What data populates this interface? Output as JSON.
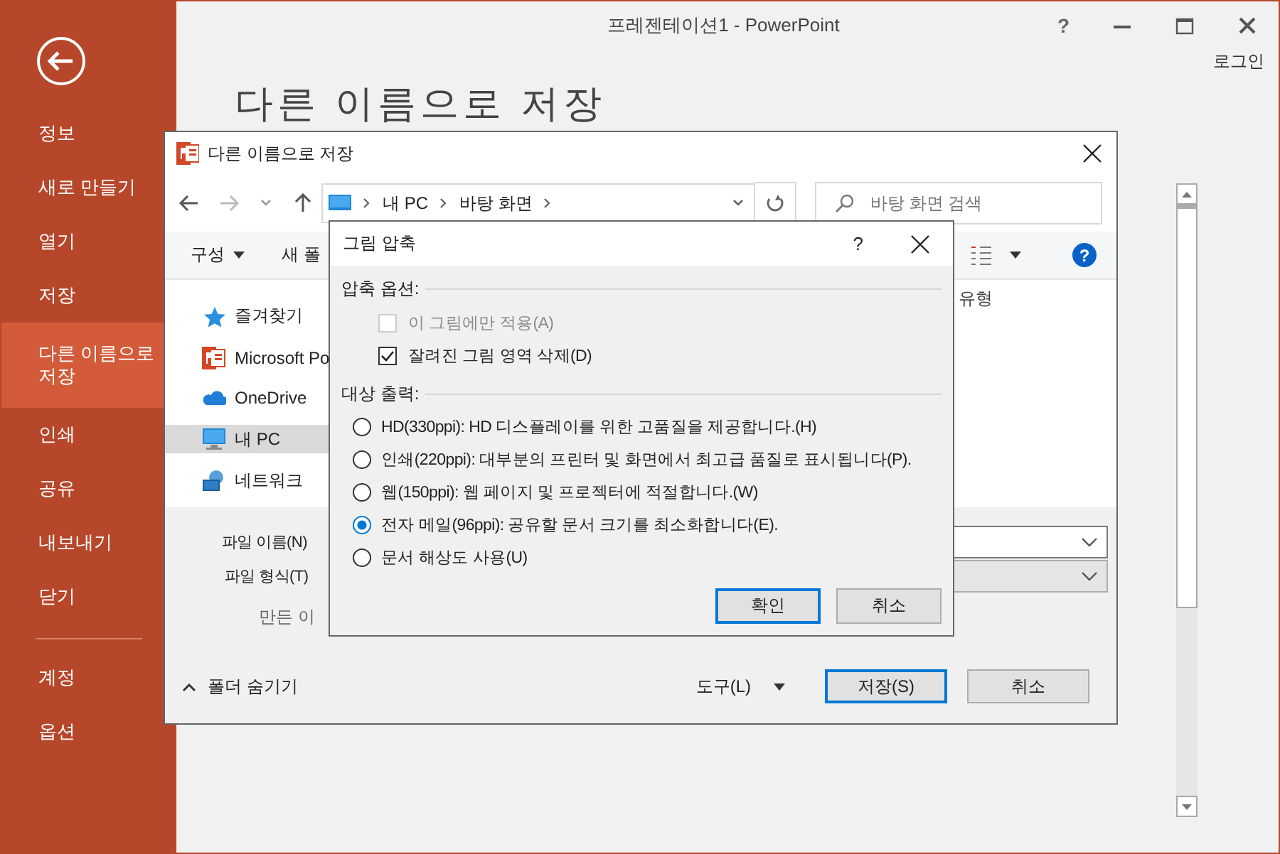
{
  "app": {
    "title": "프레젠테이션1 - PowerPoint",
    "help": "?",
    "sign_in": "로그인",
    "heading": "다른 이름으로 저장"
  },
  "backstage": {
    "items": [
      {
        "label": "정보",
        "selected": false
      },
      {
        "label": "새로 만들기",
        "selected": false
      },
      {
        "label": "열기",
        "selected": false
      },
      {
        "label": "저장",
        "selected": false
      },
      {
        "label": "다른 이름으로 저장",
        "selected": true
      },
      {
        "label": "인쇄",
        "selected": false
      },
      {
        "label": "공유",
        "selected": false
      },
      {
        "label": "내보내기",
        "selected": false
      },
      {
        "label": "닫기",
        "selected": false
      }
    ],
    "bottom_items": [
      {
        "label": "계정",
        "selected": false
      },
      {
        "label": "옵션",
        "selected": false
      }
    ]
  },
  "save_dialog": {
    "title": "다른 이름으로 저장",
    "address": [
      "내 PC",
      "바탕 화면"
    ],
    "search_placeholder": "바탕 화면 검색",
    "toolbar": {
      "organize": "구성",
      "new_folder": "새 폴",
      "help": "?"
    },
    "nav": [
      {
        "kind": "star",
        "label": "즐겨찾기",
        "selected": false
      },
      {
        "kind": "ppt",
        "label": "Microsoft Po",
        "selected": false
      },
      {
        "kind": "cloud",
        "label": "OneDrive",
        "selected": false
      },
      {
        "kind": "pc",
        "label": "내 PC",
        "selected": true
      },
      {
        "kind": "network",
        "label": "네트워크",
        "selected": false
      }
    ],
    "column_header": "유형",
    "file_name_label": "파일 이름(N)",
    "file_type_label": "파일 형식(T)",
    "author_label": "만든 이",
    "hide_folders": "폴더 숨기기",
    "tools": "도구(L)",
    "buttons": [
      {
        "label": "저장(S)",
        "default": true
      },
      {
        "label": "취소",
        "default": false
      }
    ]
  },
  "compress_dialog": {
    "title": "그림 압축",
    "help": "?",
    "sections": [
      {
        "heading": "압축 옵션:",
        "options": [
          {
            "kind": "checkbox",
            "label": "이 그림에만 적용(A)",
            "checked": false,
            "disabled": true
          },
          {
            "kind": "checkbox",
            "label": "잘려진 그림 영역 삭제(D)",
            "checked": true,
            "disabled": false
          }
        ]
      },
      {
        "heading": "대상 출력:",
        "options": [
          {
            "kind": "radio",
            "label": "HD(330ppi): HD 디스플레이를 위한 고품질을 제공합니다.(H)",
            "selected": false
          },
          {
            "kind": "radio",
            "label": "인쇄(220ppi): 대부분의 프린터 및 화면에서 최고급 품질로 표시됩니다(P).",
            "selected": false
          },
          {
            "kind": "radio",
            "label": "웹(150ppi): 웹 페이지 및 프로젝터에 적절합니다.(W)",
            "selected": false
          },
          {
            "kind": "radio",
            "label": "전자 메일(96ppi): 공유할 문서 크기를 최소화합니다(E).",
            "selected": true
          },
          {
            "kind": "radio",
            "label": "문서 해상도 사용(U)",
            "selected": false
          }
        ]
      }
    ],
    "buttons": [
      {
        "label": "확인",
        "default": true
      },
      {
        "label": "취소",
        "default": false
      }
    ]
  }
}
